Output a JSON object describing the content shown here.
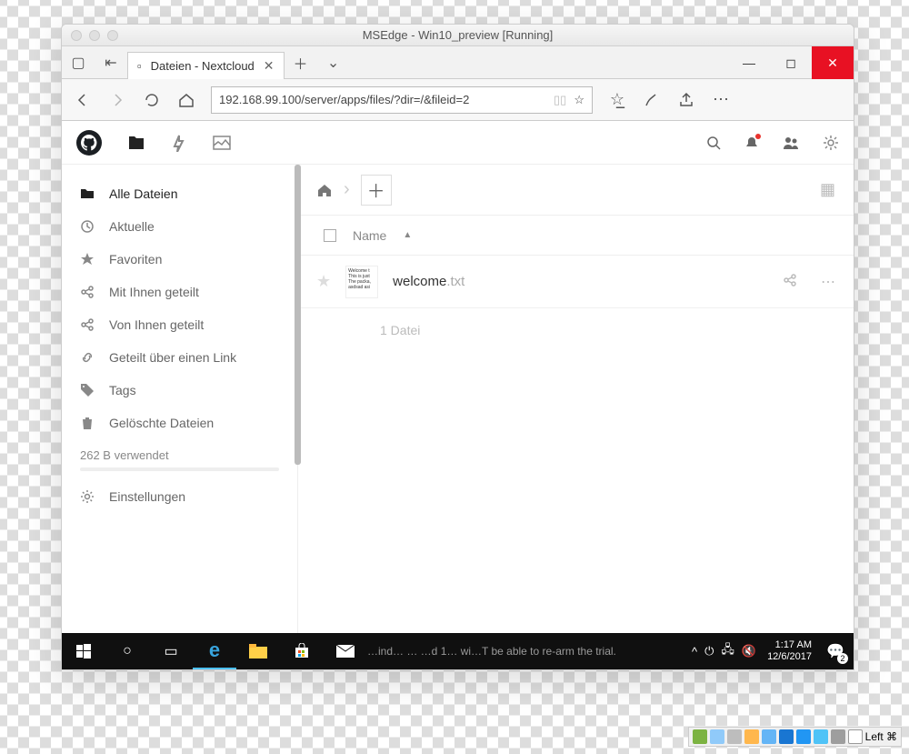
{
  "mac_title": "MSEdge - Win10_preview [Running]",
  "tab_title": "Dateien - Nextcloud",
  "address": "192.168.99.100/server/apps/files/?dir=/&fileid=2",
  "sidebar": {
    "items": [
      {
        "label": "Alle Dateien"
      },
      {
        "label": "Aktuelle"
      },
      {
        "label": "Favoriten"
      },
      {
        "label": "Mit Ihnen geteilt"
      },
      {
        "label": "Von Ihnen geteilt"
      },
      {
        "label": "Geteilt über einen Link"
      },
      {
        "label": "Tags"
      },
      {
        "label": "Gelöschte Dateien"
      }
    ],
    "usage": "262 B verwendet",
    "settings": "Einstellungen"
  },
  "list": {
    "header_name": "Name",
    "files": [
      {
        "name": "welcome",
        "ext": ".txt",
        "preview": "Welcome t\nThis is just\nThe packa,\nasdsad asi"
      }
    ],
    "summary": "1 Datei"
  },
  "taskbar": {
    "message": "…ind… … …d 1… wi…T be able to re-arm the trial.",
    "time": "1:17 AM",
    "date": "12/6/2017",
    "notif_count": "2"
  },
  "host_tray_label": "Left ⌘"
}
